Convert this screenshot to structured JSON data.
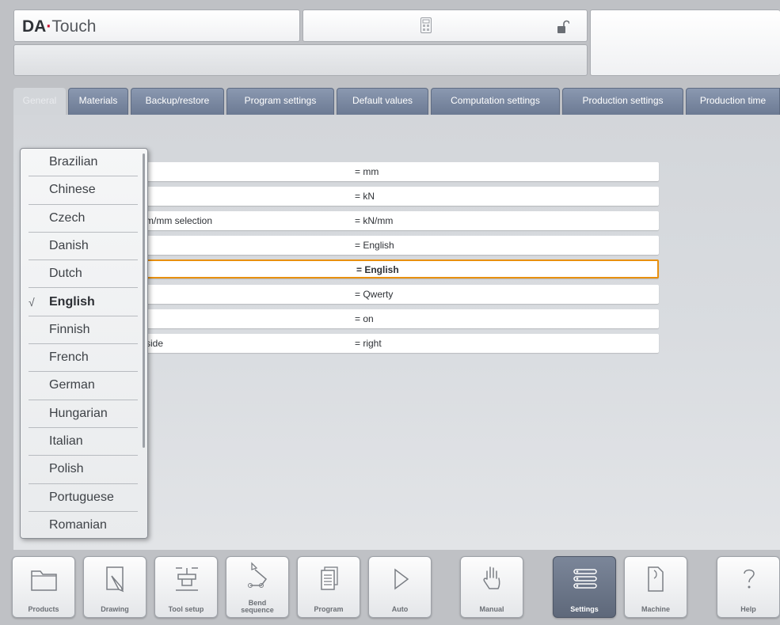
{
  "header": {
    "app_name_bold": "DA",
    "app_name_rest": "Touch",
    "calculator_icon": "calculator-icon",
    "lock_icon": "unlocked-padlock-icon"
  },
  "tabs": [
    {
      "label": "General",
      "active": true
    },
    {
      "label": "Materials"
    },
    {
      "label": "Backup/restore"
    },
    {
      "label": "Program settings"
    },
    {
      "label": "Default values"
    },
    {
      "label": "Computation settings"
    },
    {
      "label": "Production settings"
    },
    {
      "label": "Production time"
    }
  ],
  "settings_rows": [
    {
      "label": "",
      "value": "= mm"
    },
    {
      "label": "",
      "value": "= kN"
    },
    {
      "label": "m/mm selection",
      "value": "= kN/mm"
    },
    {
      "label": "",
      "value": "= English"
    },
    {
      "label": "",
      "value": "= English",
      "selected": true
    },
    {
      "label": "",
      "value": "= Qwerty"
    },
    {
      "label": "",
      "value": "= on"
    },
    {
      "label": "side",
      "value": "= right"
    }
  ],
  "language_dropdown": {
    "selected": "English",
    "check_mark": "√",
    "options": [
      "Brazilian",
      "Chinese",
      "Czech",
      "Danish",
      "Dutch",
      "English",
      "Finnish",
      "French",
      "German",
      "Hungarian",
      "Italian",
      "Polish",
      "Portuguese",
      "Romanian"
    ]
  },
  "toolbar": [
    {
      "label": "Products",
      "icon": "folder-icon"
    },
    {
      "label": "Drawing",
      "icon": "pencil-drawing-icon"
    },
    {
      "label": "Tool setup",
      "icon": "tool-setup-icon"
    },
    {
      "label_line1": "Bend",
      "label_line2": "sequence",
      "icon": "bend-sequence-icon"
    },
    {
      "label": "Program",
      "icon": "program-pages-icon"
    },
    {
      "label": "Auto",
      "icon": "play-icon"
    },
    {
      "label": "Manual",
      "icon": "hand-icon"
    },
    {
      "label": "Settings",
      "icon": "settings-list-icon",
      "active": true
    },
    {
      "label": "Machine",
      "icon": "machine-icon"
    },
    {
      "label": "Help",
      "icon": "question-mark-icon"
    }
  ],
  "colors": {
    "accent_selected": "#e8900f",
    "tab_blue": "#7a879e",
    "logo_dot": "#c8102e"
  }
}
